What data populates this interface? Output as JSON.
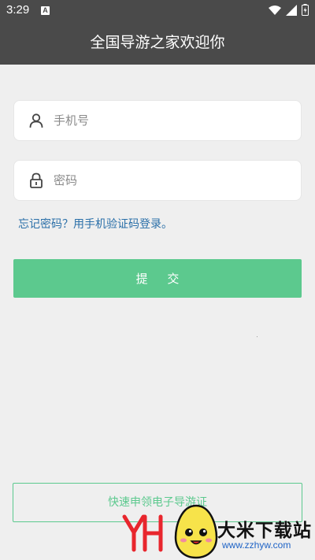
{
  "status_bar": {
    "time": "3:29",
    "notification_letter": "A"
  },
  "header": {
    "title": "全国导游之家欢迎你"
  },
  "form": {
    "phone_placeholder": "手机号",
    "password_placeholder": "密码",
    "forgot_link": "忘记密码？用手机验证码登录。",
    "submit_label": "提 交"
  },
  "quick_apply": {
    "label": "快速申领电子导游证"
  },
  "watermark": {
    "brand": "大米下载站",
    "url": "www.zzhyw.com",
    "logo_text": "YH"
  },
  "colors": {
    "header_bg": "#4a4a4a",
    "accent": "#5cc98e",
    "link": "#2a6fa8",
    "page_bg": "#efefef"
  }
}
